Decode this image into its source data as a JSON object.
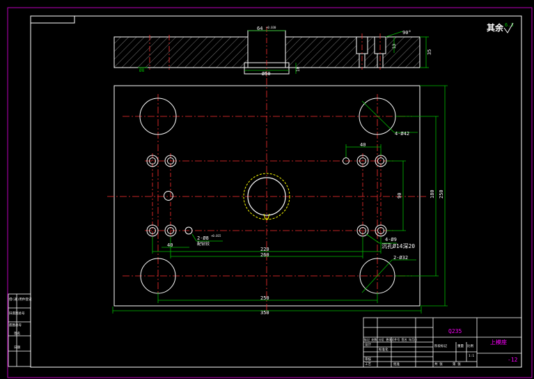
{
  "drawing": {
    "roughness_note": "其余",
    "roughness_value": "6.3",
    "section_dims": {
      "top_hole": "64",
      "top_hole_tol": "+0.030",
      "bore_dia": "Ø50",
      "left_mark": "Ø8",
      "angle": "90°",
      "depth_small": "10",
      "height": "35",
      "step_height": "10",
      "right_small": "13"
    },
    "plan_dims": {
      "hole_4x": "4-Ø42",
      "pitch_40_top": "40",
      "pitch_40_bottom": "40",
      "pin_label": "2-Ø8",
      "pin_tol": "+0.015",
      "pin_note": "配钻铰",
      "screw_label": "4-Ø9",
      "screw_note": "沉孔Ø14深20",
      "large_hole": "2-Ø32",
      "dim_220": "220",
      "dim_260": "260",
      "dim_250": "250",
      "dim_350": "350",
      "dim_90": "90",
      "dim_180": "180",
      "dim_250v": "250"
    },
    "side_block": {
      "rows": [
        "借(通)用件登记",
        "旧底图总号",
        "底图总号",
        "签名",
        "日期"
      ]
    },
    "title_block": {
      "material": "Q235",
      "part_name": "上模座",
      "drawing_no": "-12",
      "scale": "1:1",
      "header_row": "标记 处数 分区 更改文件号 签名 年月日",
      "labels": [
        "设计",
        "标准化",
        "审核",
        "工艺",
        "批准",
        "阶段标记",
        "重量",
        "比例",
        "共  张",
        "第  张"
      ]
    }
  }
}
